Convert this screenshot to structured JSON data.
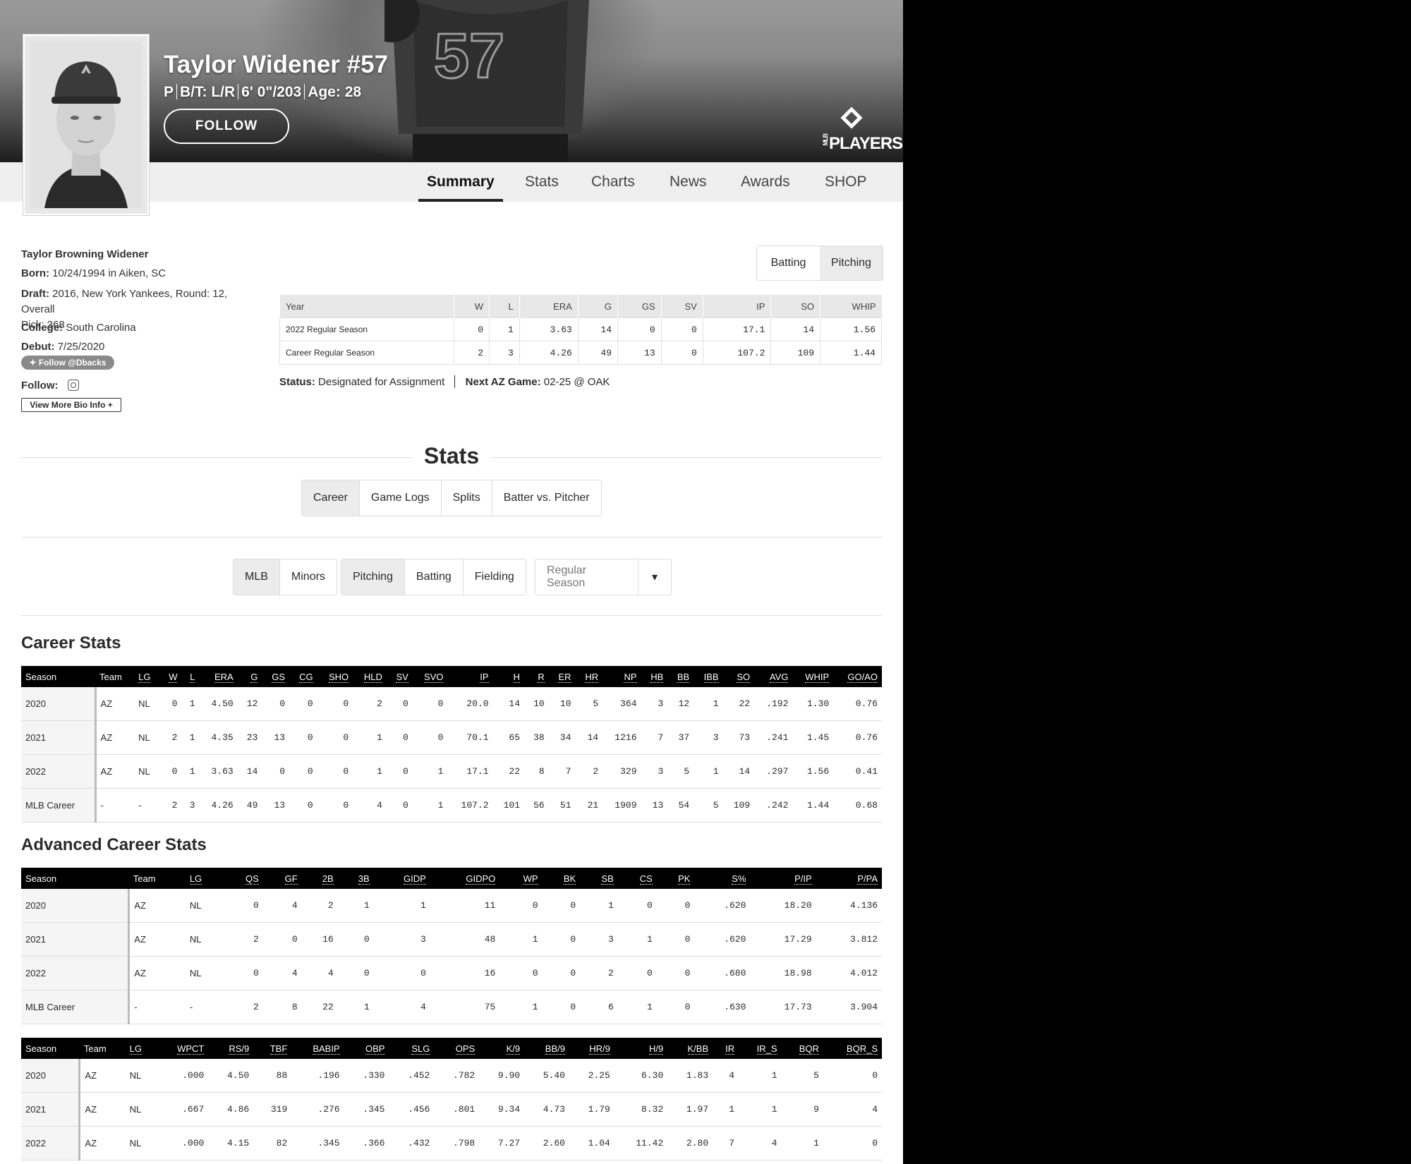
{
  "header": {
    "name": "Taylor Widener #57",
    "meta": [
      "P",
      "B/T: L/R",
      "6' 0\"/203",
      "Age: 28"
    ],
    "follow_label": "FOLLOW",
    "jersey_number": "57",
    "brand": "PLAYERS",
    "brand_prefix": "MLB"
  },
  "nav": {
    "tabs": [
      "Summary",
      "Stats",
      "Charts",
      "News",
      "Awards",
      "SHOP"
    ],
    "active": "Summary"
  },
  "bio": {
    "full_name": "Taylor Browning Widener",
    "born_label": "Born:",
    "born": "10/24/1994 in Aiken, SC",
    "draft_label": "Draft:",
    "draft_1": "2016, New York Yankees, Round: 12, Overall",
    "draft_2": "Pick: 368",
    "college_label": "College:",
    "college": "South Carolina",
    "debut_label": "Debut:",
    "debut": "7/25/2020",
    "twitter": "Follow @Dbacks",
    "follow_label": "Follow:",
    "view_more": "View More Bio Info +"
  },
  "summary": {
    "toggle": [
      "Batting",
      "Pitching"
    ],
    "headers": [
      "Year",
      "W",
      "L",
      "ERA",
      "G",
      "GS",
      "SV",
      "IP",
      "SO",
      "WHIP"
    ],
    "rows": [
      [
        "2022 Regular Season",
        "0",
        "1",
        "3.63",
        "14",
        "0",
        "0",
        "17.1",
        "14",
        "1.56"
      ],
      [
        "Career Regular Season",
        "2",
        "3",
        "4.26",
        "49",
        "13",
        "0",
        "107.2",
        "109",
        "1.44"
      ]
    ],
    "status_label": "Status:",
    "status": "Designated for Assignment",
    "next_label": "Next AZ Game:",
    "next": "02-25 @ OAK"
  },
  "stats": {
    "heading": "Stats",
    "subtabs": [
      "Career",
      "Game Logs",
      "Splits",
      "Batter vs. Pitcher"
    ],
    "filters": [
      "MLB",
      "Minors"
    ],
    "types": [
      "Pitching",
      "Batting",
      "Fielding"
    ],
    "season_select": "Regular Season"
  },
  "career": {
    "title": "Career Stats",
    "headers": [
      "Season",
      "Team",
      "LG",
      "W",
      "L",
      "ERA",
      "G",
      "GS",
      "CG",
      "SHO",
      "HLD",
      "SV",
      "SVO",
      "IP",
      "H",
      "R",
      "ER",
      "HR",
      "NP",
      "HB",
      "BB",
      "IBB",
      "SO",
      "AVG",
      "WHIP",
      "GO/AO"
    ],
    "rows": [
      [
        "2020",
        "AZ",
        "NL",
        "0",
        "1",
        "4.50",
        "12",
        "0",
        "0",
        "0",
        "2",
        "0",
        "0",
        "20.0",
        "14",
        "10",
        "10",
        "5",
        "364",
        "3",
        "12",
        "1",
        "22",
        ".192",
        "1.30",
        "0.76"
      ],
      [
        "2021",
        "AZ",
        "NL",
        "2",
        "1",
        "4.35",
        "23",
        "13",
        "0",
        "0",
        "1",
        "0",
        "0",
        "70.1",
        "65",
        "38",
        "34",
        "14",
        "1216",
        "7",
        "37",
        "3",
        "73",
        ".241",
        "1.45",
        "0.76"
      ],
      [
        "2022",
        "AZ",
        "NL",
        "0",
        "1",
        "3.63",
        "14",
        "0",
        "0",
        "0",
        "1",
        "0",
        "1",
        "17.1",
        "22",
        "8",
        "7",
        "2",
        "329",
        "3",
        "5",
        "1",
        "14",
        ".297",
        "1.56",
        "0.41"
      ],
      [
        "MLB Career",
        "-",
        "-",
        "2",
        "3",
        "4.26",
        "49",
        "13",
        "0",
        "0",
        "4",
        "0",
        "1",
        "107.2",
        "101",
        "56",
        "51",
        "21",
        "1909",
        "13",
        "54",
        "5",
        "109",
        ".242",
        "1.44",
        "0.68"
      ]
    ]
  },
  "advanced": {
    "title": "Advanced Career Stats",
    "headers": [
      "Season",
      "Team",
      "LG",
      "QS",
      "GF",
      "2B",
      "3B",
      "GIDP",
      "GIDPO",
      "WP",
      "BK",
      "SB",
      "CS",
      "PK",
      "S%",
      "P/IP",
      "P/PA"
    ],
    "rows": [
      [
        "2020",
        "AZ",
        "NL",
        "0",
        "4",
        "2",
        "1",
        "1",
        "11",
        "0",
        "0",
        "1",
        "0",
        "0",
        ".620",
        "18.20",
        "4.136"
      ],
      [
        "2021",
        "AZ",
        "NL",
        "2",
        "0",
        "16",
        "0",
        "3",
        "48",
        "1",
        "0",
        "3",
        "1",
        "0",
        ".620",
        "17.29",
        "3.812"
      ],
      [
        "2022",
        "AZ",
        "NL",
        "0",
        "4",
        "4",
        "0",
        "0",
        "16",
        "0",
        "0",
        "2",
        "0",
        "0",
        ".680",
        "18.98",
        "4.012"
      ],
      [
        "MLB Career",
        "-",
        "-",
        "2",
        "8",
        "22",
        "1",
        "4",
        "75",
        "1",
        "0",
        "6",
        "1",
        "0",
        ".630",
        "17.73",
        "3.904"
      ]
    ]
  },
  "advanced2": {
    "headers": [
      "Season",
      "Team",
      "LG",
      "WPCT",
      "RS/9",
      "TBF",
      "BABIP",
      "OBP",
      "SLG",
      "OPS",
      "K/9",
      "BB/9",
      "HR/9",
      "H/9",
      "K/BB",
      "IR",
      "IR_S",
      "BQR",
      "BQR_S"
    ],
    "rows": [
      [
        "2020",
        "AZ",
        "NL",
        ".000",
        "4.50",
        "88",
        ".196",
        ".330",
        ".452",
        ".782",
        "9.90",
        "5.40",
        "2.25",
        "6.30",
        "1.83",
        "4",
        "1",
        "5",
        "0"
      ],
      [
        "2021",
        "AZ",
        "NL",
        ".667",
        "4.86",
        "319",
        ".276",
        ".345",
        ".456",
        ".801",
        "9.34",
        "4.73",
        "1.79",
        "8.32",
        "1.97",
        "1",
        "1",
        "9",
        "4"
      ],
      [
        "2022",
        "AZ",
        "NL",
        ".000",
        "4.15",
        "82",
        ".345",
        ".366",
        ".432",
        ".798",
        "7.27",
        "2.60",
        "1.04",
        "11.42",
        "2.80",
        "7",
        "4",
        "1",
        "0"
      ]
    ]
  }
}
